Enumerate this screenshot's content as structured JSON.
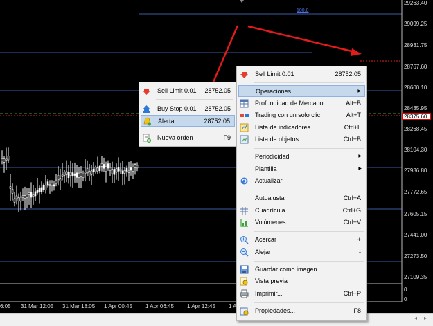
{
  "chart": {
    "price_levels": [
      "29263.40",
      "29099.25",
      "28931.75",
      "28767.60",
      "28600.10",
      "28435.95",
      "28375.60",
      "28268.45",
      "28104.30",
      "27936.80",
      "27772.65",
      "27605.15",
      "27441.00",
      "27273.50",
      "27109.35"
    ],
    "volume_levels": [
      "0",
      "0"
    ],
    "current_price": "28375.60",
    "time_labels": [
      "6:05",
      "31 Mar 12:05",
      "31 Mar 18:05",
      "1 Apr 00:45",
      "1 Apr 06:45",
      "1 Apr 12:45",
      "1 Ap"
    ],
    "level_label": "100.0",
    "colors": {
      "background": "#000000",
      "candles": "#ffffff",
      "hlines": "#3a5ba0",
      "arrow": "#e41b1b",
      "bid_line": "#3fa03f",
      "ask_line": "#e02020"
    }
  },
  "left_menu": {
    "items": [
      {
        "icon": "sell-limit-icon",
        "label": "Sell Limit 0.01",
        "shortcut": "28752.05"
      },
      {
        "icon": "buy-stop-icon",
        "label": "Buy Stop 0.01",
        "shortcut": "28752.05"
      },
      {
        "icon": "alert-bell-icon",
        "label": "Alerta",
        "shortcut": "28752.05"
      },
      {
        "icon": "new-order-icon",
        "label": "Nueva orden",
        "shortcut": "F9"
      }
    ]
  },
  "right_menu": {
    "items": [
      {
        "icon": "sell-limit-icon",
        "label": "Sell Limit 0.01",
        "shortcut": "28752.05"
      },
      {
        "icon": "",
        "label": "Operaciones",
        "shortcut": ""
      },
      {
        "icon": "market-depth-icon",
        "label": "Profundidad de Mercado",
        "shortcut": "Alt+B"
      },
      {
        "icon": "one-click-trading-icon",
        "label": "Trading con un solo clic",
        "shortcut": "Alt+T"
      },
      {
        "icon": "indicators-list-icon",
        "label": "Lista de indicadores",
        "shortcut": "Ctrl+L"
      },
      {
        "icon": "objects-list-icon",
        "label": "Lista de objetos",
        "shortcut": "Ctrl+B"
      },
      {
        "icon": "",
        "label": "Periodicidad",
        "shortcut": ""
      },
      {
        "icon": "",
        "label": "Plantilla",
        "shortcut": ""
      },
      {
        "icon": "refresh-icon",
        "label": "Actualizar",
        "shortcut": ""
      },
      {
        "icon": "",
        "label": "Autoajustar",
        "shortcut": "Ctrl+A"
      },
      {
        "icon": "grid-icon",
        "label": "Cuadrícula",
        "shortcut": "Ctrl+G"
      },
      {
        "icon": "volumes-icon",
        "label": "Volúmenes",
        "shortcut": "Ctrl+V"
      },
      {
        "icon": "zoom-in-icon",
        "label": "Acercar",
        "shortcut": "+"
      },
      {
        "icon": "zoom-out-icon",
        "label": "Alejar",
        "shortcut": "-"
      },
      {
        "icon": "save-image-icon",
        "label": "Guardar como imagen...",
        "shortcut": ""
      },
      {
        "icon": "print-preview-icon",
        "label": "Vista previa",
        "shortcut": ""
      },
      {
        "icon": "print-icon",
        "label": "Imprimir...",
        "shortcut": "Ctrl+P"
      },
      {
        "icon": "properties-icon",
        "label": "Propiedades...",
        "shortcut": "F8"
      }
    ]
  }
}
